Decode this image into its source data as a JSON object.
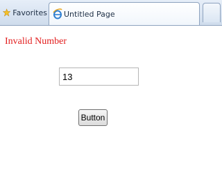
{
  "browser": {
    "favorites_label": "Favorites",
    "tab_title": "Untitled Page"
  },
  "page": {
    "error_message": "Invalid Number",
    "number_field_value": "13",
    "button_label": "Button"
  },
  "colors": {
    "error": "#e21c1c"
  }
}
